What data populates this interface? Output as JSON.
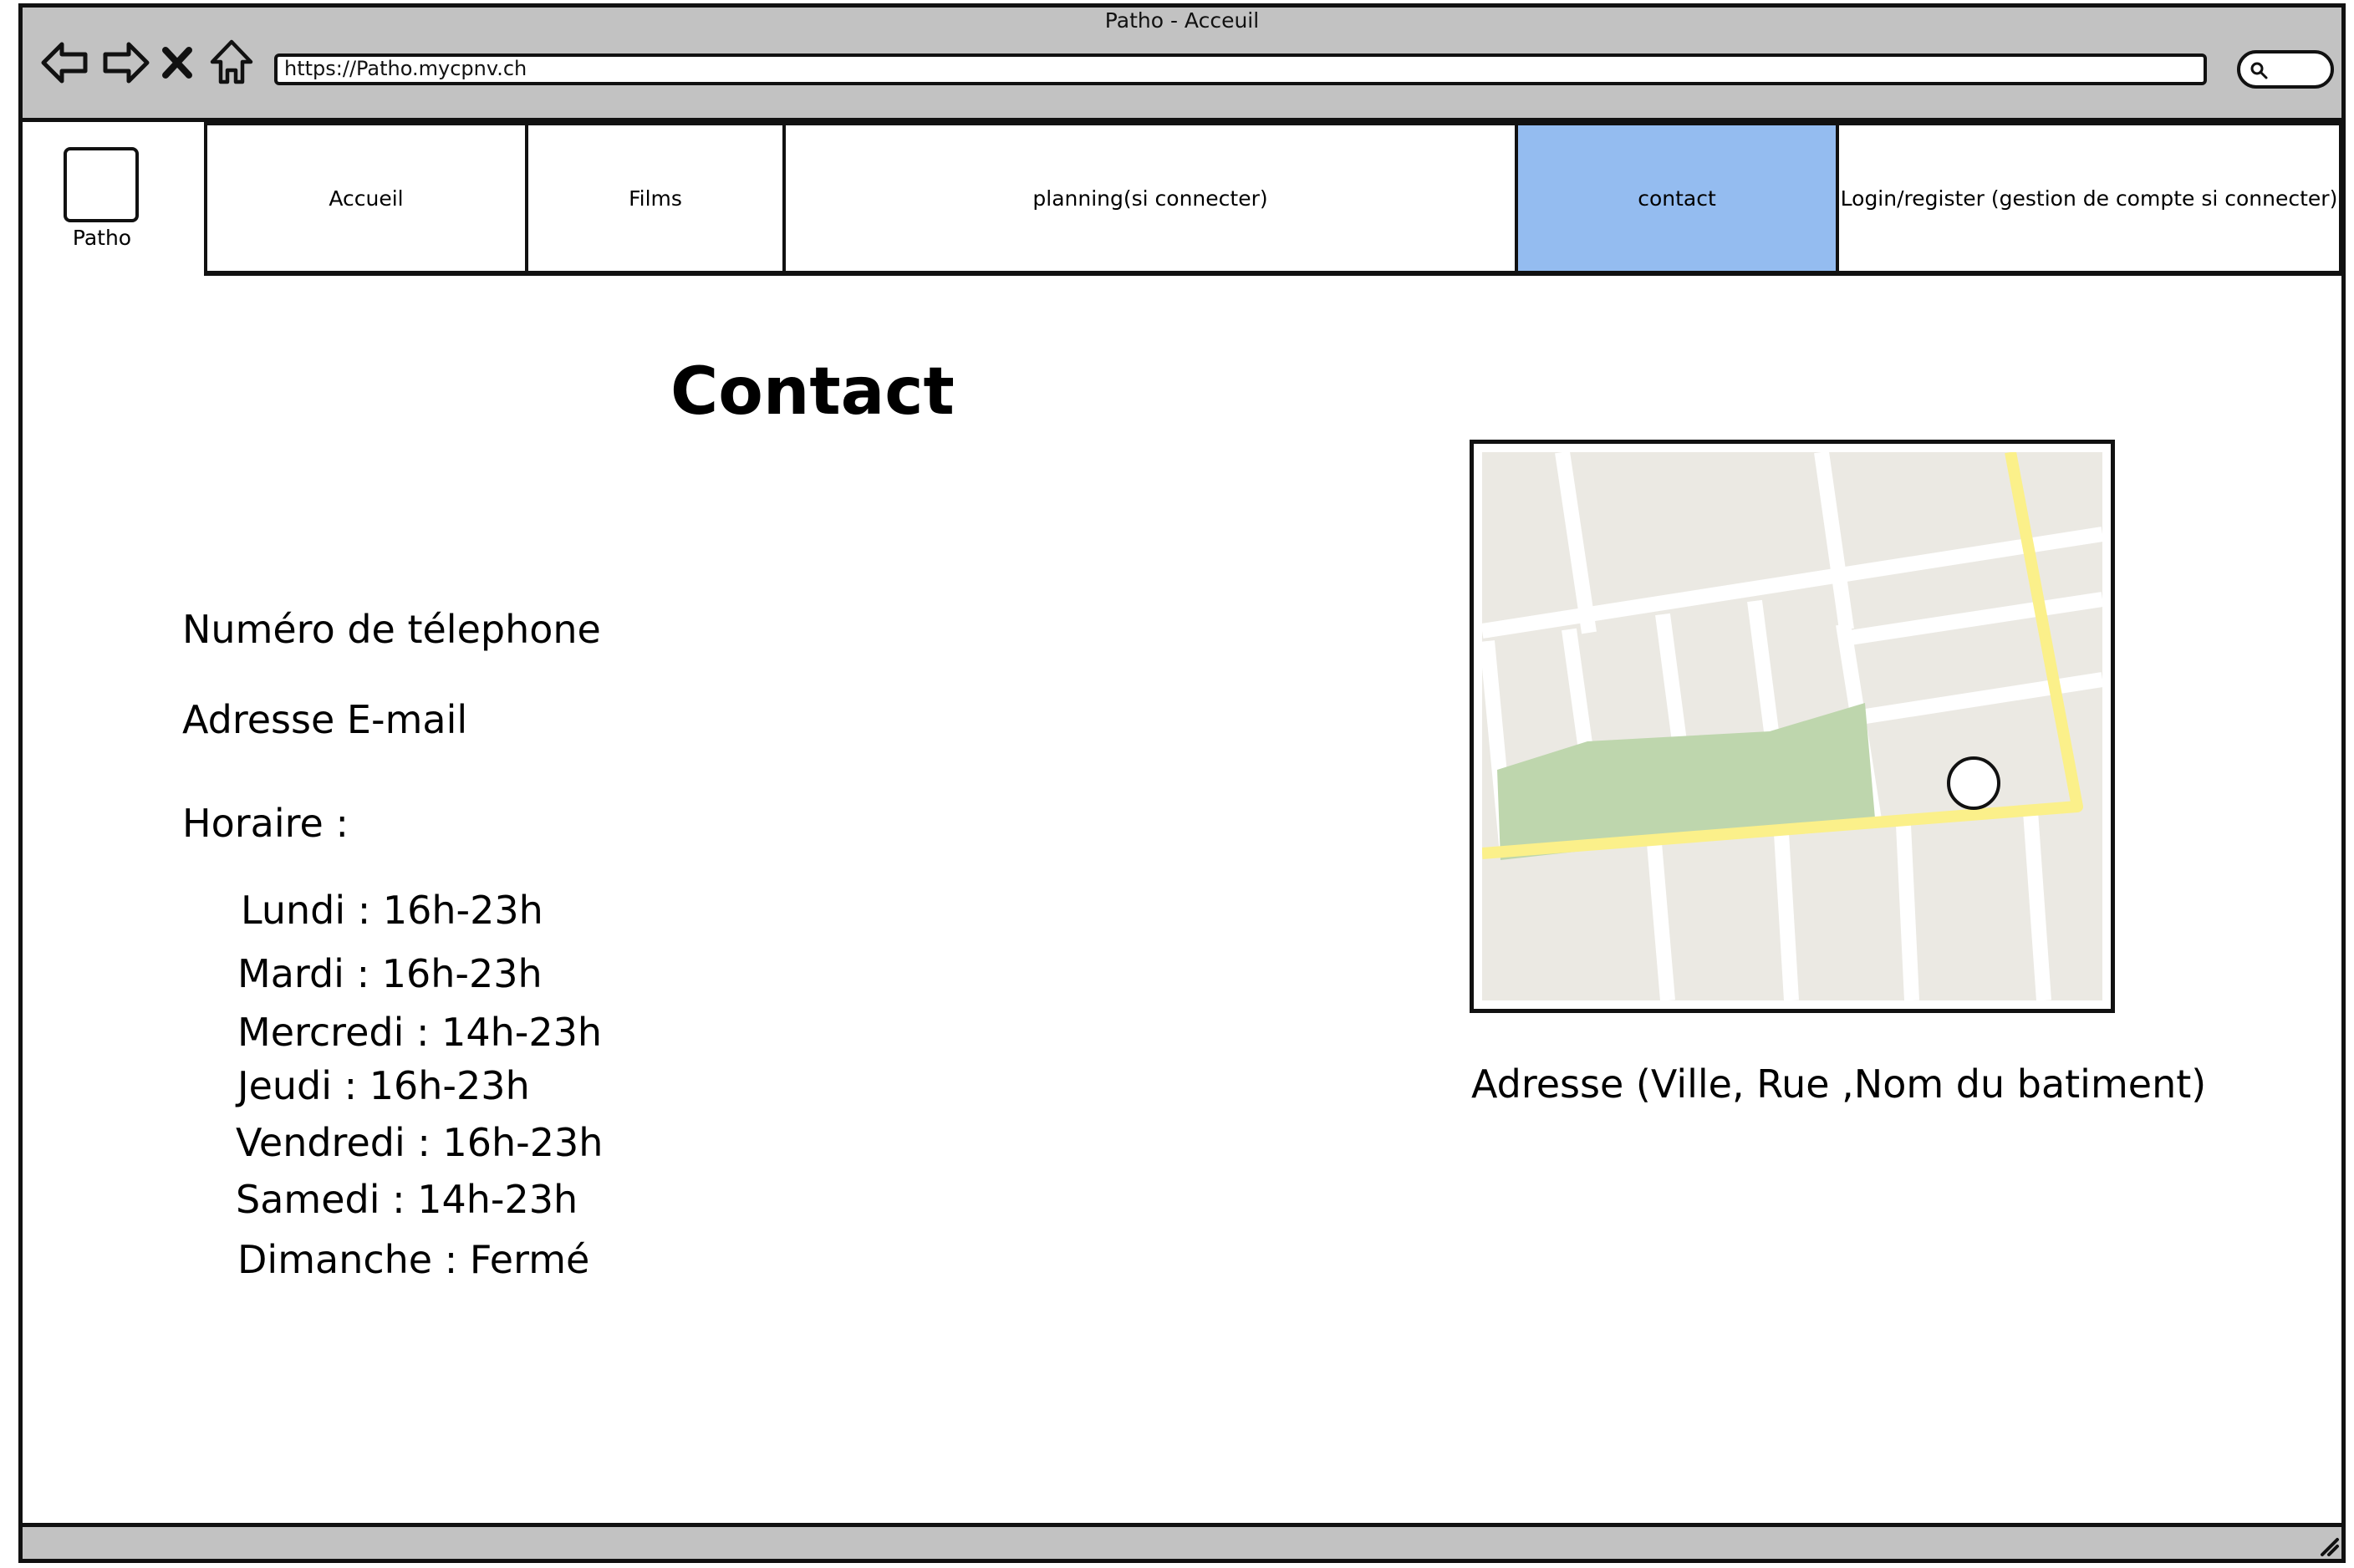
{
  "window": {
    "title": "Patho - Acceuil"
  },
  "toolbar": {
    "url": "https://Patho.mycpnv.ch",
    "icons": [
      "back-arrow-icon",
      "forward-arrow-icon",
      "close-icon",
      "home-icon",
      "search-icon"
    ]
  },
  "logo": {
    "label": "Patho"
  },
  "nav": {
    "items": [
      {
        "label": "Accueil"
      },
      {
        "label": "Films"
      },
      {
        "label": "planning(si connecter)"
      },
      {
        "label": "contact",
        "active": true
      },
      {
        "label": "Login/register (gestion de compte si connecter)"
      }
    ],
    "active_color": "#94bcf0"
  },
  "content": {
    "title": "Contact",
    "phone_label": "Numéro de télephone",
    "email_label": "Adresse E-mail",
    "schedule_label": "Horaire :",
    "schedule": [
      "Lundi : 16h-23h",
      "Mardi : 16h-23h",
      "Mercredi : 14h-23h",
      "Jeudi : 16h-23h",
      "Vendredi : 16h-23h",
      "Samedi : 14h-23h",
      "Dimanche : Fermé"
    ],
    "address": "Adresse (Ville, Rue ,Nom du batiment)"
  },
  "map": {
    "land_color": "#ebe9e3",
    "park_color": "#bed6ad",
    "main_road_color": "#fbf08a"
  }
}
